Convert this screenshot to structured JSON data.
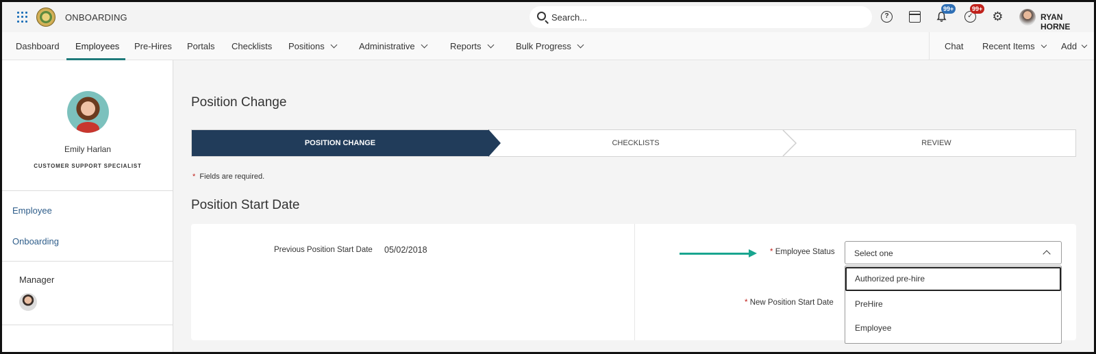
{
  "app": {
    "title": "ONBOARDING"
  },
  "search": {
    "placeholder": "Search..."
  },
  "topbar": {
    "notifications_badge": "99+",
    "tasks_badge": "99+",
    "help_glyph": "?",
    "tasks_glyph": "✓",
    "gear_glyph": "⚙",
    "user_name": "RYAN HORNE"
  },
  "nav": {
    "items": [
      {
        "label": "Dashboard"
      },
      {
        "label": "Employees",
        "active": true
      },
      {
        "label": "Pre-Hires"
      },
      {
        "label": "Portals"
      },
      {
        "label": "Checklists"
      },
      {
        "label": "Positions",
        "dropdown": true
      },
      {
        "label": "Administrative",
        "dropdown": true
      },
      {
        "label": "Reports",
        "dropdown": true
      },
      {
        "label": "Bulk Progress",
        "dropdown": true
      }
    ],
    "right": [
      {
        "label": "Chat"
      },
      {
        "label": "Recent Items",
        "dropdown": true
      },
      {
        "label": "Add",
        "dropdown": true
      }
    ]
  },
  "sidebar": {
    "employee_name": "Emily Harlan",
    "employee_title": "CUSTOMER SUPPORT SPECIALIST",
    "links": [
      "Employee",
      "Onboarding"
    ],
    "manager_label": "Manager"
  },
  "main": {
    "page_title": "Position Change",
    "steps": [
      {
        "label": "POSITION CHANGE",
        "active": true
      },
      {
        "label": "CHECKLISTS",
        "active": false
      },
      {
        "label": "REVIEW",
        "active": false
      }
    ],
    "required_star": "*",
    "required_note": "Fields are required.",
    "section_title": "Position Start Date",
    "previous_start_label": "Previous Position Start Date",
    "previous_start_value": "05/02/2018",
    "employee_status_label": "Employee Status",
    "employee_status_placeholder": "Select one",
    "employee_status_options": [
      "Authorized pre-hire",
      "PreHire",
      "Employee"
    ],
    "new_start_label": "New Position Start Date"
  },
  "colors": {
    "accent_teal": "#18a58f",
    "step_active": "#213c5a",
    "badge_blue": "#2e6fb5",
    "badge_red": "#c0211b",
    "link_blue": "#2e5d8a"
  },
  "icons": [
    "apps-grid-icon",
    "org-logo",
    "search-icon",
    "help-icon",
    "calendar-icon",
    "bell-icon",
    "check-circle-icon",
    "gear-icon",
    "chevron-down-icon",
    "chevron-up-icon",
    "arrow-right-icon"
  ]
}
